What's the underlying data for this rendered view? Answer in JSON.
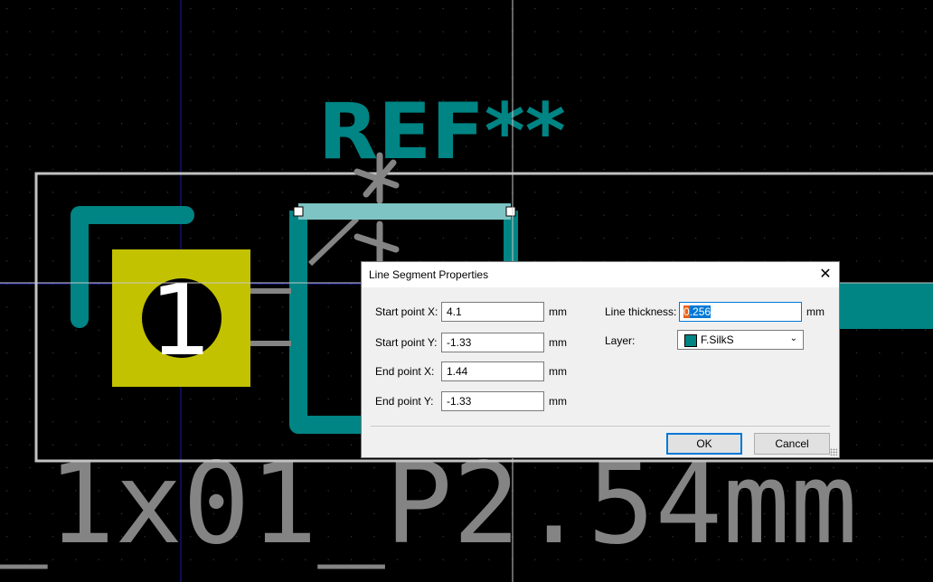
{
  "canvas": {
    "ref_text": "REF**",
    "pad_number": "1",
    "value_text": "_1x01_P2.54mm",
    "colors": {
      "background": "#000000",
      "silkscreen": "#008484",
      "pad": "#c2c200",
      "fab": "#848484",
      "courtyard": "#c2c2c2",
      "selected_line": "#7fc4c4"
    }
  },
  "dialog": {
    "title": "Line Segment Properties",
    "close_icon": "close-icon",
    "start_x": {
      "label": "Start point X:",
      "value": "4.1",
      "unit": "mm"
    },
    "start_y": {
      "label": "Start point Y:",
      "value": "-1.33",
      "unit": "mm"
    },
    "end_x": {
      "label": "End point X:",
      "value": "1.44",
      "unit": "mm"
    },
    "end_y": {
      "label": "End point Y:",
      "value": "-1.33",
      "unit": "mm"
    },
    "thickness": {
      "label": "Line thickness:",
      "value": "0.256",
      "value_first": "0",
      "value_rest": ".256",
      "unit": "mm"
    },
    "layer": {
      "label": "Layer:",
      "value": "F.SilkS",
      "swatch_color": "#008484"
    },
    "ok_label": "OK",
    "cancel_label": "Cancel"
  }
}
